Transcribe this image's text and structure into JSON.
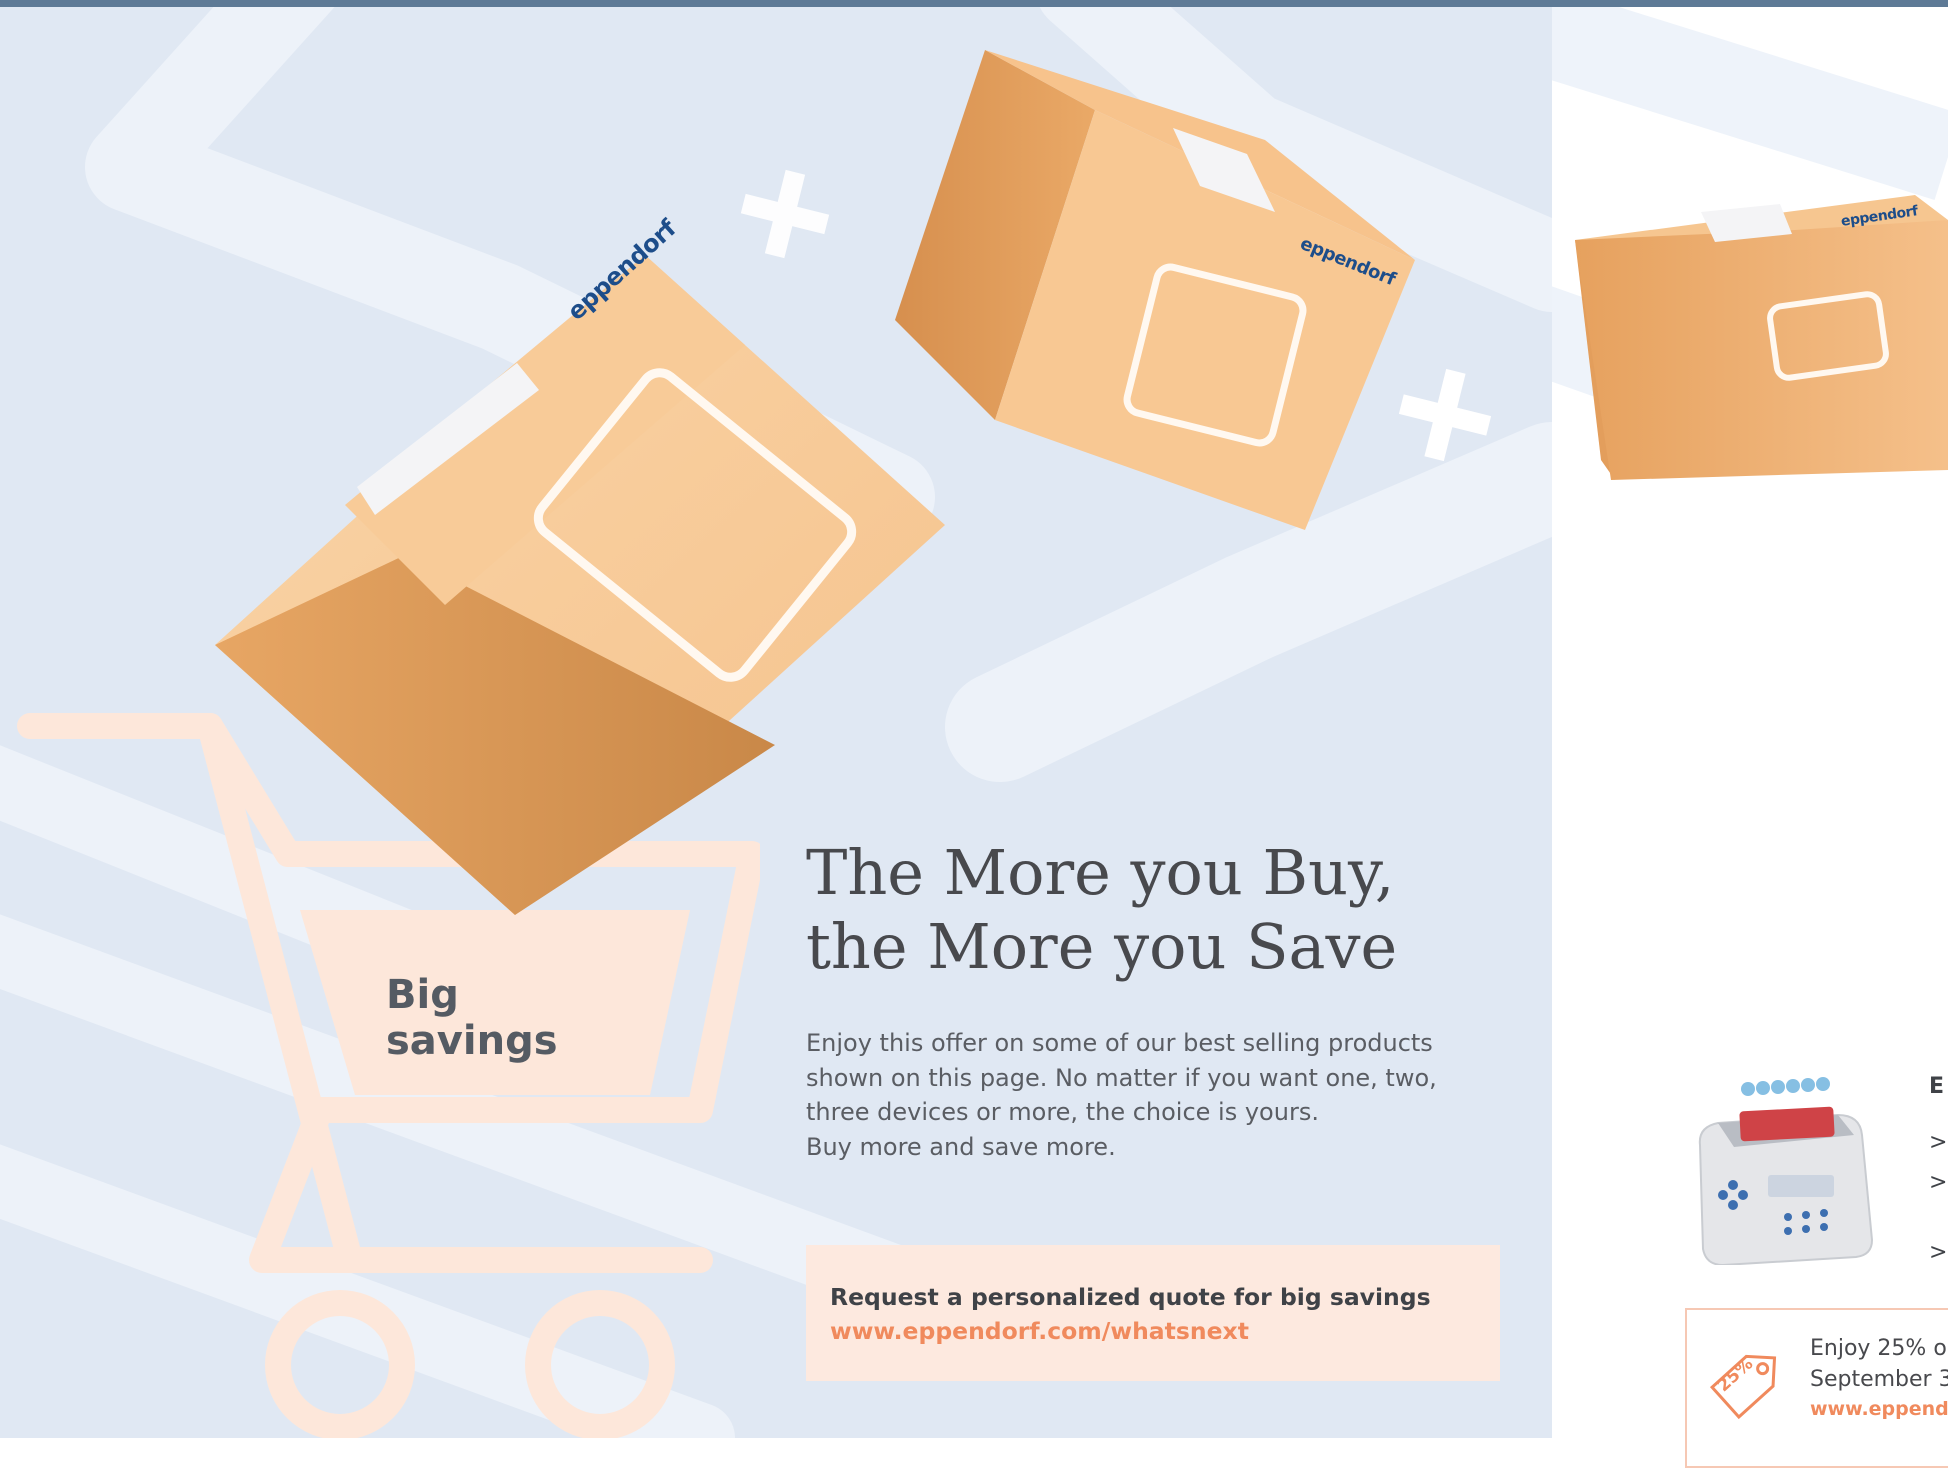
{
  "brand": {
    "name": "eppendorf",
    "accent_color": "#f08a5d",
    "brand_color": "#1d4d8a"
  },
  "cart": {
    "label": "Big savings"
  },
  "headline": {
    "line1": "The More you Buy,",
    "line2": "the More you Save"
  },
  "body": {
    "lines": [
      "Enjoy this offer on some of our best selling products",
      "shown on this page. No matter if you want one, two,",
      "three devices or more, the choice is yours.",
      "Buy more and save more."
    ]
  },
  "cta": {
    "title": "Request a personalized quote for big savings",
    "link": "www.eppendorf.com/whatsnext"
  },
  "product": {
    "title_fragment": "E",
    "bullets": [
      ">",
      ">",
      ">"
    ]
  },
  "offer": {
    "badge": "25%",
    "line1": "Enjoy 25% o",
    "line2": "September 3",
    "link": "www.eppend"
  }
}
